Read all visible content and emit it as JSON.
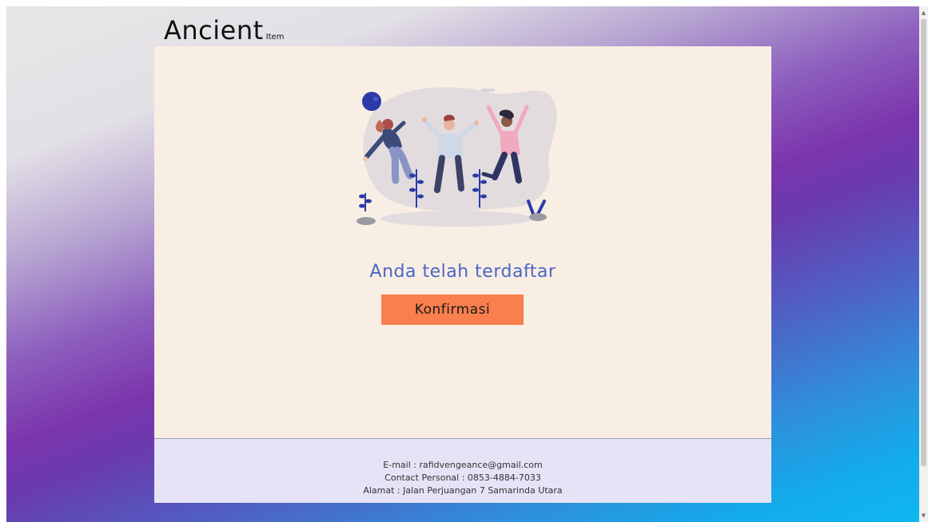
{
  "brand": {
    "name": "Ancient",
    "sub": "Item"
  },
  "main": {
    "headline": "Anda telah terdaftar",
    "button_label": "Konfirmasi"
  },
  "footer": {
    "email": "E-mail : rafidvengeance@gmail.com",
    "contact": "Contact Personal : 0853-4884-7033",
    "address": "Alamat : Jalan Perjuangan 7 Samarinda Utara"
  },
  "colors": {
    "card_bg": "#f9eee4",
    "footer_bg": "#e5e3f5",
    "accent_button": "#f97f4d",
    "headline": "#4a66c6"
  },
  "icons": {
    "illustration": "people-jumping-celebration-illustration",
    "scroll_up": "scroll-up-arrow-icon",
    "scroll_down": "scroll-down-arrow-icon"
  }
}
